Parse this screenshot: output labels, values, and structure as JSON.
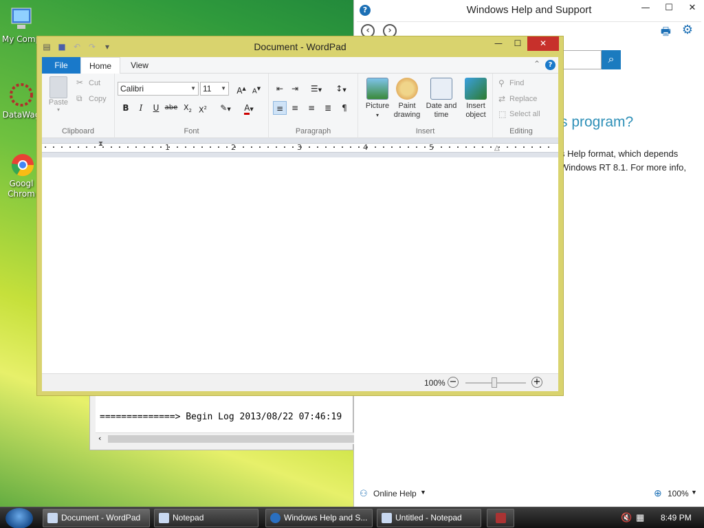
{
  "desktop": {
    "icons": [
      {
        "label": "My Comp"
      },
      {
        "label": "DataWag"
      },
      {
        "label": "Googl Chrom"
      }
    ]
  },
  "help_window": {
    "title": "Windows Help and Support",
    "heading": "s program?",
    "paragraph_line1": "s Help format, which depends",
    "paragraph_line2": "Windows RT 8.1. For more info,",
    "online_help_label": "Online Help",
    "zoom_label": "100%"
  },
  "notepad_window": {
    "text": "==============> Begin Log 2013/08/22 07:46:19"
  },
  "wordpad": {
    "title": "Document - WordPad",
    "tabs": {
      "file": "File",
      "home": "Home",
      "view": "View"
    },
    "clipboard": {
      "paste": "Paste",
      "cut": "Cut",
      "copy": "Copy",
      "label": "Clipboard"
    },
    "font": {
      "family": "Calibri",
      "size": "11",
      "label": "Font"
    },
    "paragraph": {
      "label": "Paragraph"
    },
    "insert": {
      "picture": "Picture",
      "paint_drawing": "Paint drawing",
      "date_time": "Date and time",
      "insert_object": "Insert object",
      "label": "Insert"
    },
    "editing": {
      "find": "Find",
      "replace": "Replace",
      "select_all": "Select all",
      "label": "Editing"
    },
    "ruler_numbers": [
      "1",
      "2",
      "3",
      "4",
      "5"
    ],
    "zoom": "100%"
  },
  "taskbar": {
    "tasks": [
      {
        "label": "Document - WordPad"
      },
      {
        "label": "Notepad"
      },
      {
        "label": "Windows Help and S..."
      },
      {
        "label": "Untitled - Notepad"
      }
    ],
    "clock": "8:49 PM"
  }
}
